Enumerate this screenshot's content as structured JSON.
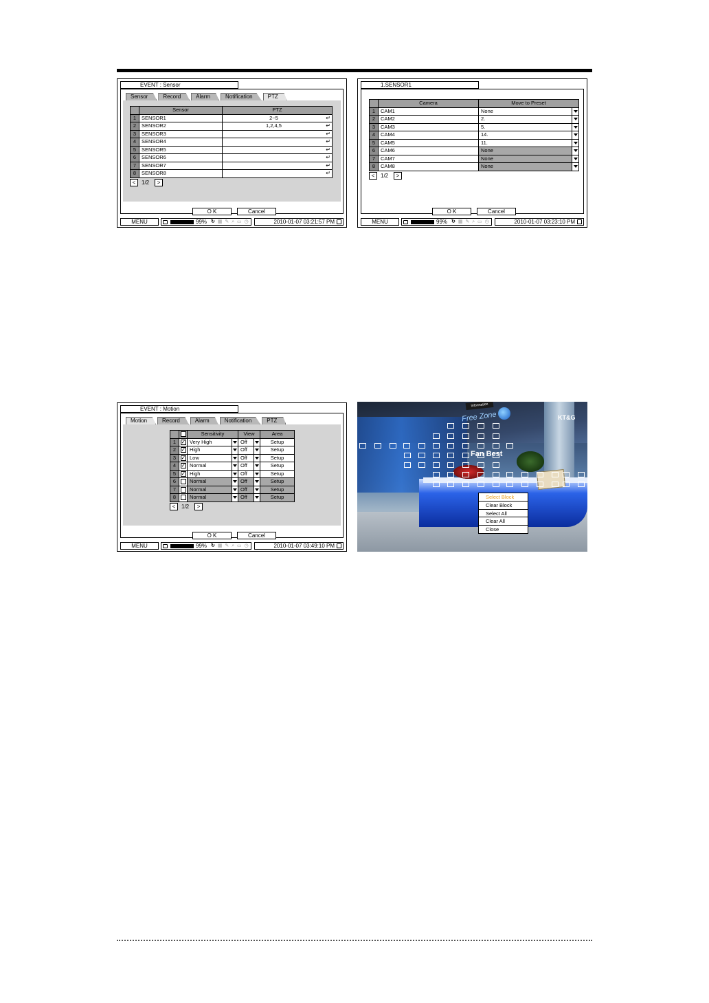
{
  "panel_sensor": {
    "title": "EVENT : Sensor",
    "tabs": [
      "Sensor",
      "Record",
      "Alarm",
      "Notification",
      "PTZ"
    ],
    "columns": [
      "Sensor",
      "PTZ"
    ],
    "rows": [
      {
        "n": "1",
        "sensor": "SENSOR1",
        "ptz": "2~5"
      },
      {
        "n": "2",
        "sensor": "SENSOR2",
        "ptz": "1,2,4,5"
      },
      {
        "n": "3",
        "sensor": "SENSOR3",
        "ptz": ""
      },
      {
        "n": "4",
        "sensor": "SENSOR4",
        "ptz": ""
      },
      {
        "n": "5",
        "sensor": "SENSOR5",
        "ptz": ""
      },
      {
        "n": "6",
        "sensor": "SENSOR6",
        "ptz": ""
      },
      {
        "n": "7",
        "sensor": "SENSOR7",
        "ptz": ""
      },
      {
        "n": "8",
        "sensor": "SENSOR8",
        "ptz": ""
      }
    ],
    "page": "1/2",
    "ok": "O K",
    "cancel": "Cancel",
    "menu": "MENU",
    "hdd": "99%",
    "time": "2010-01-07 03:21:57 PM"
  },
  "panel_preset": {
    "title": "1.SENSOR1",
    "columns": [
      "Camera",
      "Move to Preset"
    ],
    "rows": [
      {
        "n": "1",
        "camera": "CAM1",
        "preset": "None"
      },
      {
        "n": "2",
        "camera": "CAM2",
        "preset": "2."
      },
      {
        "n": "3",
        "camera": "CAM3",
        "preset": "5."
      },
      {
        "n": "4",
        "camera": "CAM4",
        "preset": "14."
      },
      {
        "n": "5",
        "camera": "CAM5",
        "preset": "11."
      },
      {
        "n": "6",
        "camera": "CAM6",
        "preset": "None"
      },
      {
        "n": "7",
        "camera": "CAM7",
        "preset": "None"
      },
      {
        "n": "8",
        "camera": "CAM8",
        "preset": "None"
      }
    ],
    "page": "1/2",
    "ok": "O K",
    "cancel": "Cancel",
    "menu": "MENU",
    "hdd": "99%",
    "time": "2010-01-07 03:23:10 PM"
  },
  "panel_motion": {
    "title": "EVENT : Motion",
    "tabs": [
      "Motion",
      "Record",
      "Alarm",
      "Notification",
      "PTZ"
    ],
    "columns": [
      "Sensitivity",
      "View",
      "Area"
    ],
    "rows": [
      {
        "n": "1",
        "checked": true,
        "sensitivity": "Very High",
        "view": "Off",
        "area": "Setup"
      },
      {
        "n": "2",
        "checked": true,
        "sensitivity": "High",
        "view": "Off",
        "area": "Setup"
      },
      {
        "n": "3",
        "checked": true,
        "sensitivity": "Low",
        "view": "Off",
        "area": "Setup"
      },
      {
        "n": "4",
        "checked": true,
        "sensitivity": "Normal",
        "view": "Off",
        "area": "Setup"
      },
      {
        "n": "5",
        "checked": true,
        "sensitivity": "High",
        "view": "Off",
        "area": "Setup"
      },
      {
        "n": "6",
        "checked": false,
        "sensitivity": "Normal",
        "view": "Off",
        "area": "Setup"
      },
      {
        "n": "7",
        "checked": false,
        "sensitivity": "Normal",
        "view": "Off",
        "area": "Setup"
      },
      {
        "n": "8",
        "checked": false,
        "sensitivity": "Normal",
        "view": "Off",
        "area": "Setup"
      }
    ],
    "page": "1/2",
    "ok": "O K",
    "cancel": "Cancel",
    "menu": "MENU",
    "hdd": "99%",
    "time": "2010-01-07 03:49:10 PM"
  },
  "camera_view": {
    "signs": [
      "Information",
      "Free Zone",
      "KT&G",
      "Fan Best"
    ],
    "context_menu": [
      "Select Block",
      "Clear Block",
      "Select All",
      "Clear All",
      "Close"
    ],
    "highlight_color": "#e8a020"
  }
}
